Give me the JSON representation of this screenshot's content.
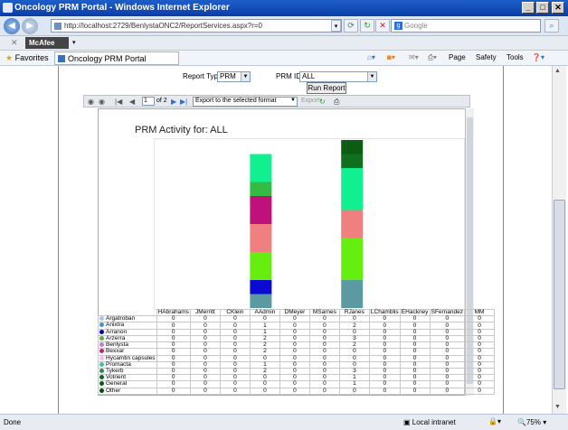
{
  "window": {
    "title": "Oncology PRM Portal - Windows Internet Explorer"
  },
  "address_bar": {
    "url": "http://localhost:2729/BenlystaONC2/ReportServices.aspx?r=0",
    "search_placeholder": "Google"
  },
  "toolbar": {
    "mcafee": "McAfee"
  },
  "favorites_bar": {
    "favorites_label": "Favorites",
    "tab_title": "Oncology PRM Portal",
    "page_menu": "Page",
    "safety_menu": "Safety",
    "tools_menu": "Tools"
  },
  "params": {
    "report_type_label": "Report Type",
    "report_type_value": "PRM",
    "prm_id_label": "PRM ID",
    "prm_id_value": "ALL",
    "run_button": "Run Report"
  },
  "report_toolbar": {
    "page_current": "1",
    "page_total": "of 2",
    "export_format": "Export to the selected format",
    "export_label": "Export"
  },
  "report": {
    "title": "PRM Activity for:  ALL",
    "columns": [
      "HAbrahams",
      "JMerritt",
      "CKlein",
      "AAdmin",
      "DMeyer",
      "MSarnes",
      "RJanes",
      "LChamblis",
      "EHackney",
      "SFernandez",
      "MM"
    ],
    "rows": [
      {
        "label": "Argatroban",
        "color": "#a9c7e8",
        "values": [
          "0",
          "0",
          "0",
          "0",
          "0",
          "0",
          "0",
          "0",
          "0",
          "0",
          "0"
        ]
      },
      {
        "label": "Anixtra",
        "color": "#4a90c8",
        "values": [
          "0",
          "0",
          "0",
          "1",
          "0",
          "0",
          "2",
          "0",
          "0",
          "0",
          "0"
        ]
      },
      {
        "label": "Arranon",
        "color": "#0000cc",
        "values": [
          "0",
          "0",
          "0",
          "1",
          "0",
          "0",
          "0",
          "0",
          "0",
          "0",
          "0"
        ]
      },
      {
        "label": "Arzerra",
        "color": "#5aaa5a",
        "values": [
          "0",
          "0",
          "0",
          "2",
          "0",
          "0",
          "3",
          "0",
          "0",
          "0",
          "0"
        ]
      },
      {
        "label": "Benlysta",
        "color": "#c080c0",
        "values": [
          "0",
          "0",
          "0",
          "2",
          "0",
          "0",
          "2",
          "0",
          "0",
          "0",
          "0"
        ]
      },
      {
        "label": "Bexxar",
        "color": "#c02080",
        "values": [
          "0",
          "0",
          "0",
          "2",
          "0",
          "0",
          "0",
          "0",
          "0",
          "0",
          "0"
        ]
      },
      {
        "label": "Hycamtin capsules",
        "color": "#f0c0e0",
        "values": [
          "0",
          "0",
          "0",
          "0",
          "0",
          "0",
          "0",
          "0",
          "0",
          "0",
          "0"
        ]
      },
      {
        "label": "Promacta",
        "color": "#40c0a0",
        "values": [
          "0",
          "0",
          "0",
          "1",
          "0",
          "0",
          "0",
          "0",
          "0",
          "0",
          "0"
        ]
      },
      {
        "label": "Tykerb",
        "color": "#2c8c4c",
        "values": [
          "0",
          "0",
          "0",
          "2",
          "0",
          "0",
          "3",
          "0",
          "0",
          "0",
          "0"
        ]
      },
      {
        "label": "Votrient",
        "color": "#0a6a2a",
        "values": [
          "0",
          "0",
          "0",
          "0",
          "0",
          "0",
          "1",
          "0",
          "0",
          "0",
          "0"
        ]
      },
      {
        "label": "General",
        "color": "#0a5a1a",
        "values": [
          "0",
          "0",
          "0",
          "0",
          "0",
          "0",
          "1",
          "0",
          "0",
          "0",
          "0"
        ]
      },
      {
        "label": "Other",
        "color": "#0a4a10",
        "values": [
          "0",
          "0",
          "0",
          "0",
          "0",
          "0",
          "0",
          "0",
          "0",
          "0",
          "0"
        ]
      }
    ]
  },
  "chart_data": {
    "type": "bar",
    "stacked": true,
    "categories": [
      "HAbrahams",
      "JMerritt",
      "CKlein",
      "AAdmin",
      "DMeyer",
      "MSarnes",
      "RJanes",
      "LChamblis",
      "EHackney",
      "SFernandez",
      "MM"
    ],
    "series": [
      {
        "name": "Argatroban",
        "color": "#a9c7e8",
        "values": [
          0,
          0,
          0,
          0,
          0,
          0,
          0,
          0,
          0,
          0,
          0
        ]
      },
      {
        "name": "Anixtra",
        "color": "#5b9aa0",
        "values": [
          0,
          0,
          0,
          1,
          0,
          0,
          2,
          0,
          0,
          0,
          0
        ]
      },
      {
        "name": "Arranon",
        "color": "#0a0ad0",
        "values": [
          0,
          0,
          0,
          1,
          0,
          0,
          0,
          0,
          0,
          0,
          0
        ]
      },
      {
        "name": "Arzerra",
        "color": "#66ee10",
        "values": [
          0,
          0,
          0,
          2,
          0,
          0,
          3,
          0,
          0,
          0,
          0
        ]
      },
      {
        "name": "Benlysta",
        "color": "#f08080",
        "values": [
          0,
          0,
          0,
          2,
          0,
          0,
          2,
          0,
          0,
          0,
          0
        ]
      },
      {
        "name": "Bexxar",
        "color": "#c0107a",
        "values": [
          0,
          0,
          0,
          2,
          0,
          0,
          0,
          0,
          0,
          0,
          0
        ]
      },
      {
        "name": "Hycamtin capsules",
        "color": "#f0c0e0",
        "values": [
          0,
          0,
          0,
          0,
          0,
          0,
          0,
          0,
          0,
          0,
          0
        ]
      },
      {
        "name": "Promacta",
        "color": "#33bb44",
        "values": [
          0,
          0,
          0,
          1,
          0,
          0,
          0,
          0,
          0,
          0,
          0
        ]
      },
      {
        "name": "Tykerb",
        "color": "#10f090",
        "values": [
          0,
          0,
          0,
          2,
          0,
          0,
          3,
          0,
          0,
          0,
          0
        ]
      },
      {
        "name": "Votrient",
        "color": "#107020",
        "values": [
          0,
          0,
          0,
          0,
          0,
          0,
          1,
          0,
          0,
          0,
          0
        ]
      },
      {
        "name": "General",
        "color": "#0c5c14",
        "values": [
          0,
          0,
          0,
          0,
          0,
          0,
          1,
          0,
          0,
          0,
          0
        ]
      },
      {
        "name": "Other",
        "color": "#0a4a10",
        "values": [
          0,
          0,
          0,
          0,
          0,
          0,
          0,
          0,
          0,
          0,
          0
        ]
      }
    ],
    "ylim": [
      0,
      12
    ]
  },
  "status_bar": {
    "status_text": "Done",
    "zone": "Local intranet",
    "zoom": "75%"
  }
}
